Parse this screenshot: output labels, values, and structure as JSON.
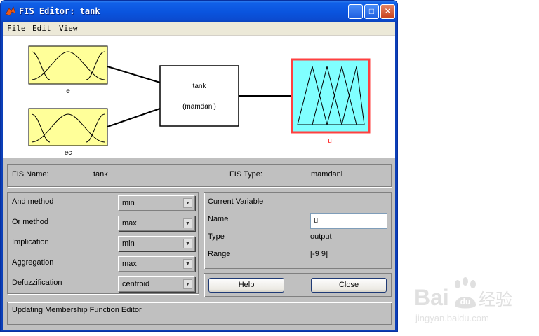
{
  "window": {
    "title": "FIS Editor: tank",
    "controls": {
      "minimize": "_",
      "maximize": "□",
      "close": "✕"
    }
  },
  "menu": {
    "items": [
      "File",
      "Edit",
      "View"
    ]
  },
  "diagram": {
    "inputs": [
      {
        "label": "e"
      },
      {
        "label": "ec"
      }
    ],
    "system": {
      "name": "tank",
      "type": "(mamdani)"
    },
    "output": {
      "label": "u"
    },
    "colors": {
      "input_fill": "#ffff99",
      "output_fill": "#80ffff",
      "selected_border": "#ff4040",
      "output_label": "#ff0000"
    }
  },
  "fis_info": {
    "name_label": "FIS Name:",
    "name_value": "tank",
    "type_label": "FIS Type:",
    "type_value": "mamdani"
  },
  "methods": [
    {
      "label": "And method",
      "value": "min"
    },
    {
      "label": "Or method",
      "value": "max"
    },
    {
      "label": "Implication",
      "value": "min"
    },
    {
      "label": "Aggregation",
      "value": "max"
    },
    {
      "label": "Defuzzification",
      "value": "centroid"
    }
  ],
  "current_variable": {
    "title": "Current Variable",
    "name_label": "Name",
    "name_value": "u",
    "type_label": "Type",
    "type_value": "output",
    "range_label": "Range",
    "range_value": "[-9 9]"
  },
  "buttons": {
    "help": "Help",
    "close": "Close"
  },
  "status": {
    "text": "Updating Membership Function Editor"
  },
  "watermark": {
    "brand": "Bai",
    "paw": "du",
    "cn": "经验",
    "url": "jingyan.baidu.com"
  }
}
